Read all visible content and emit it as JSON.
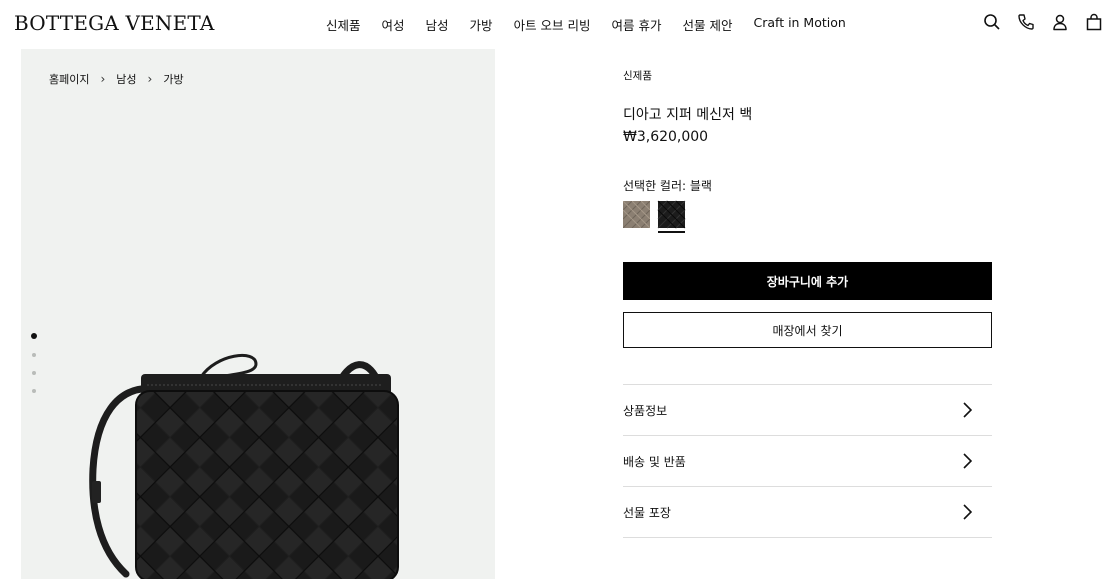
{
  "header": {
    "logo": "BOTTEGA VENETA",
    "nav": [
      "신제품",
      "여성",
      "남성",
      "가방",
      "아트 오브 리빙",
      "여름 휴가",
      "선물 제안",
      "Craft in Motion"
    ],
    "icons": [
      "search-icon",
      "phone-icon",
      "account-icon",
      "bag-icon"
    ]
  },
  "breadcrumb": [
    "홈페이지",
    "남성",
    "가방"
  ],
  "gallery": {
    "image_count": 4,
    "active_index": 0
  },
  "product": {
    "tag": "신제품",
    "name": "디아고 지퍼 메신저 백",
    "price": "₩3,620,000",
    "color_label": "선택한 컬러: 블랙",
    "swatches": [
      {
        "name": "taupe",
        "color": "#8b7f72"
      },
      {
        "name": "black",
        "color": "#1c1c1c",
        "selected": true
      }
    ],
    "add_to_cart": "장바구니에 추가",
    "find_store": "매장에서 찾기",
    "accordion": [
      "상품정보",
      "배송 및 반품",
      "선물 포장"
    ]
  }
}
